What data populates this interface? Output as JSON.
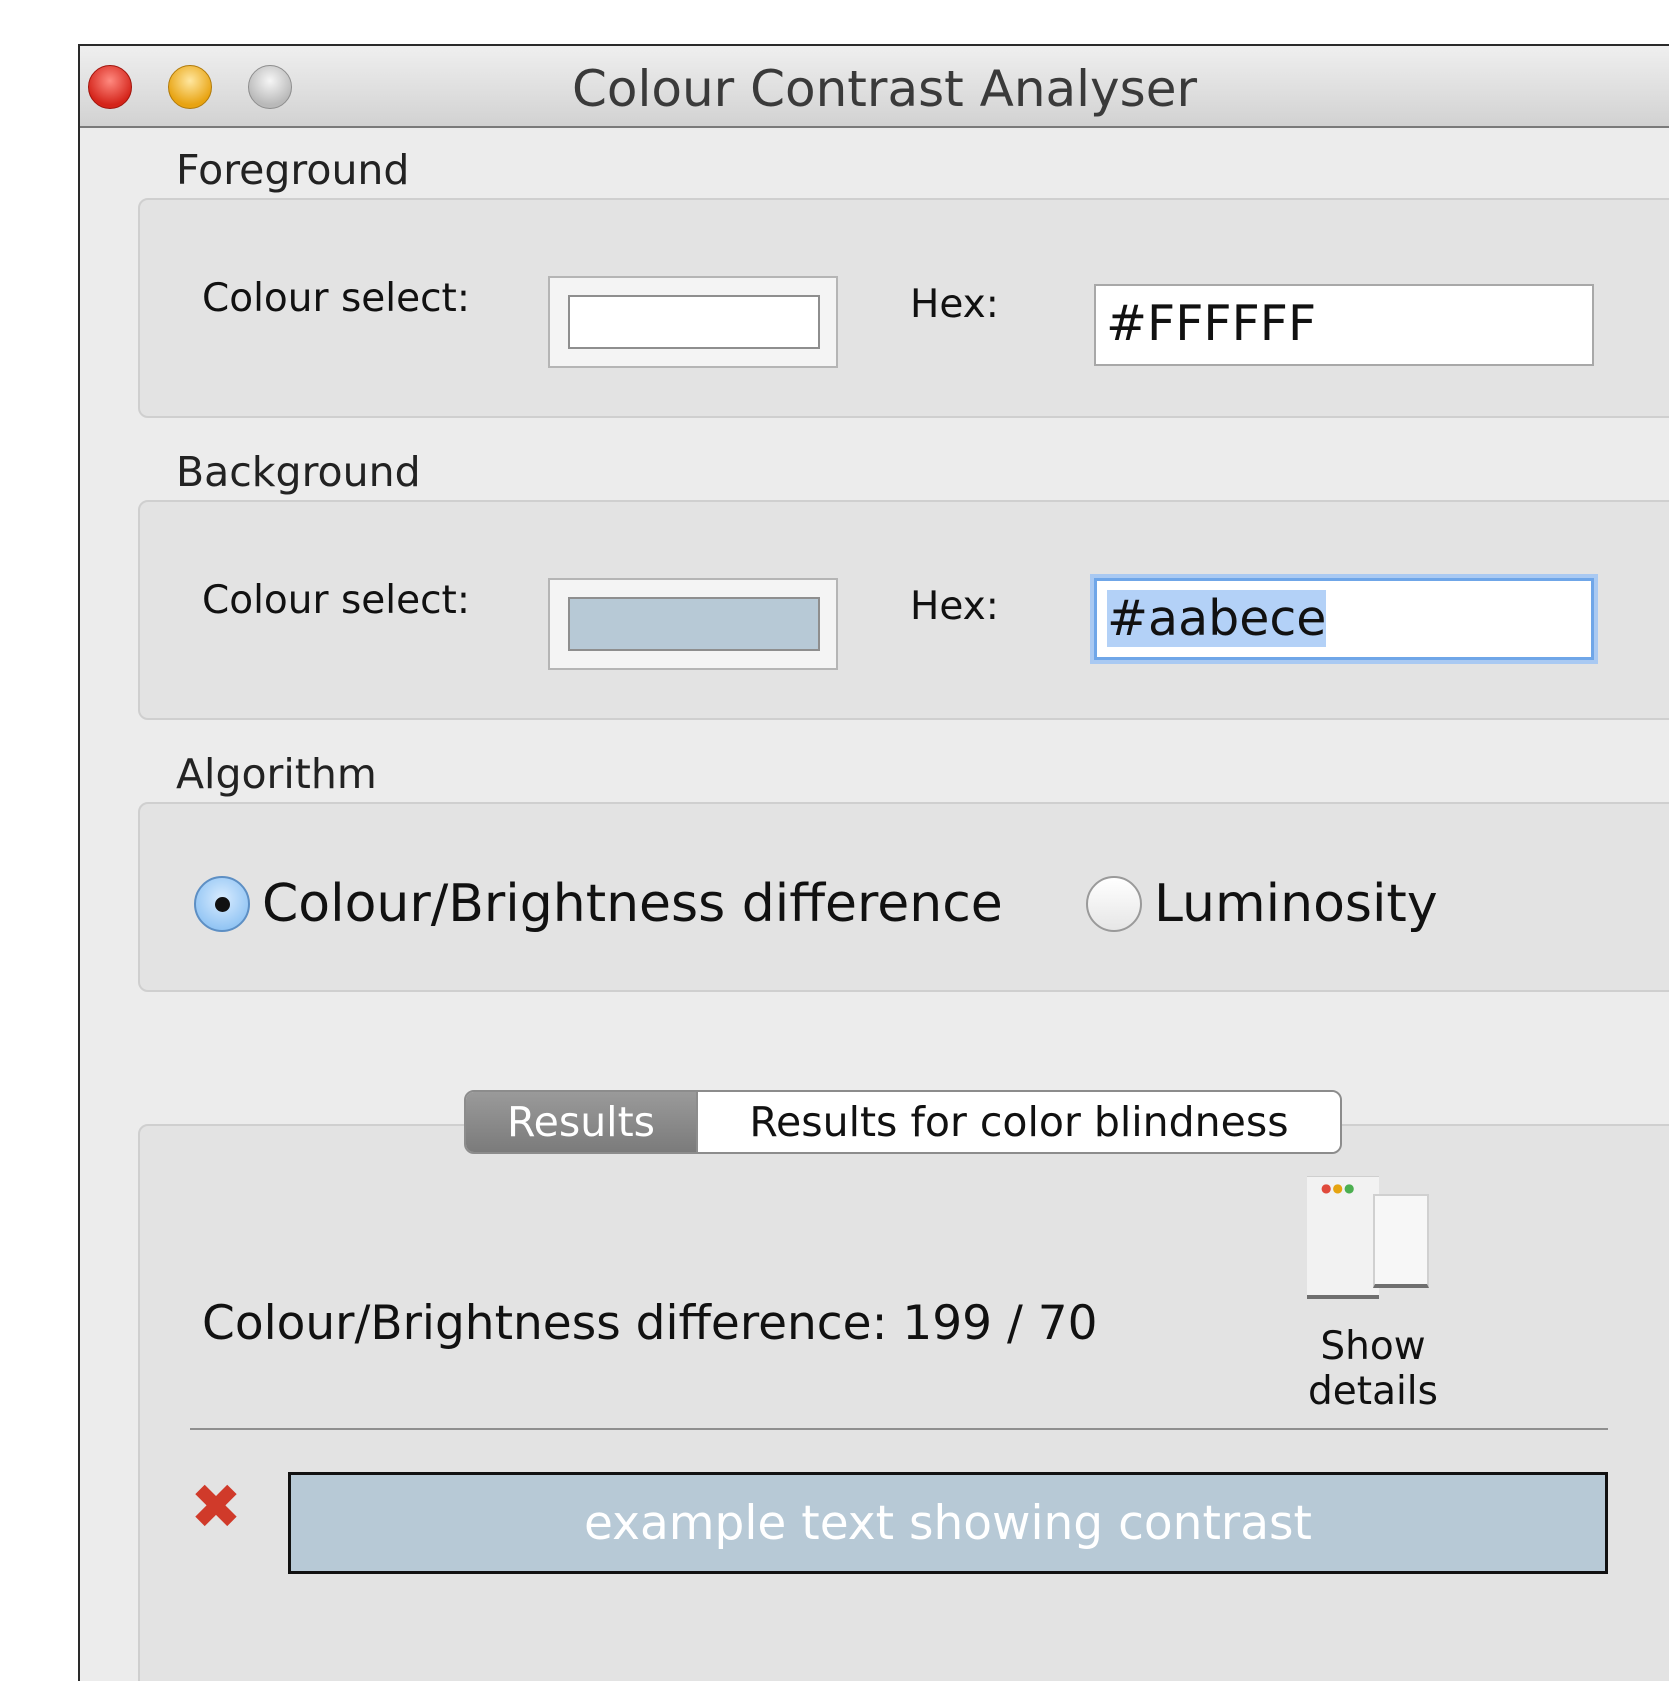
{
  "window": {
    "title": "Colour Contrast Analyser"
  },
  "foreground": {
    "section_label": "Foreground",
    "colour_select_label": "Colour select:",
    "hex_label": "Hex:",
    "hex_value": "#FFFFFF",
    "swatch_color": "#ffffff"
  },
  "background": {
    "section_label": "Background",
    "colour_select_label": "Colour select:",
    "hex_label": "Hex:",
    "hex_value": "#aabece",
    "swatch_color": "#b7c9d6"
  },
  "algorithm": {
    "section_label": "Algorithm",
    "options": [
      {
        "label": "Colour/Brightness difference",
        "selected": true
      },
      {
        "label": "Luminosity",
        "selected": false
      }
    ]
  },
  "results": {
    "tabs": [
      {
        "label": "Results",
        "active": true
      },
      {
        "label": "Results for color blindness",
        "active": false
      }
    ],
    "summary": "Colour/Brightness difference: 199  /  70",
    "show_details_label": "Show details",
    "status_icon": "fail-x-icon",
    "sample_text": "example text showing contrast",
    "sample_fg": "#ffffff",
    "sample_bg": "#b7c9d6"
  }
}
